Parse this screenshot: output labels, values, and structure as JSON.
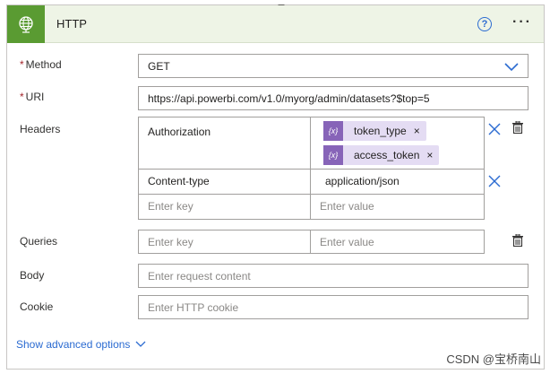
{
  "header": {
    "title": "HTTP",
    "help_icon": "question-circle-icon",
    "more_icon": "ellipsis-icon",
    "app_icon": "globe-icon",
    "accent": "#5a9b32"
  },
  "method": {
    "label": "Method",
    "required_mark": "*",
    "value": "GET"
  },
  "uri": {
    "label": "URI",
    "required_mark": "*",
    "value": "https://api.powerbi.com/v1.0/myorg/admin/datasets?$top=5"
  },
  "headers": {
    "label": "Headers",
    "rows": [
      {
        "key": "Authorization",
        "tokens": [
          "token_type",
          "access_token"
        ]
      },
      {
        "key": "Content-type",
        "value": "application/json"
      }
    ],
    "key_placeholder": "Enter key",
    "value_placeholder": "Enter value"
  },
  "queries": {
    "label": "Queries",
    "key_placeholder": "Enter key",
    "value_placeholder": "Enter value"
  },
  "body": {
    "label": "Body",
    "placeholder": "Enter request content"
  },
  "cookie": {
    "label": "Cookie",
    "placeholder": "Enter HTTP cookie"
  },
  "advanced": {
    "label": "Show advanced options"
  },
  "watermark": "CSDN @宝桥南山",
  "token_close": "×",
  "token_icon_glyph": "{x}"
}
